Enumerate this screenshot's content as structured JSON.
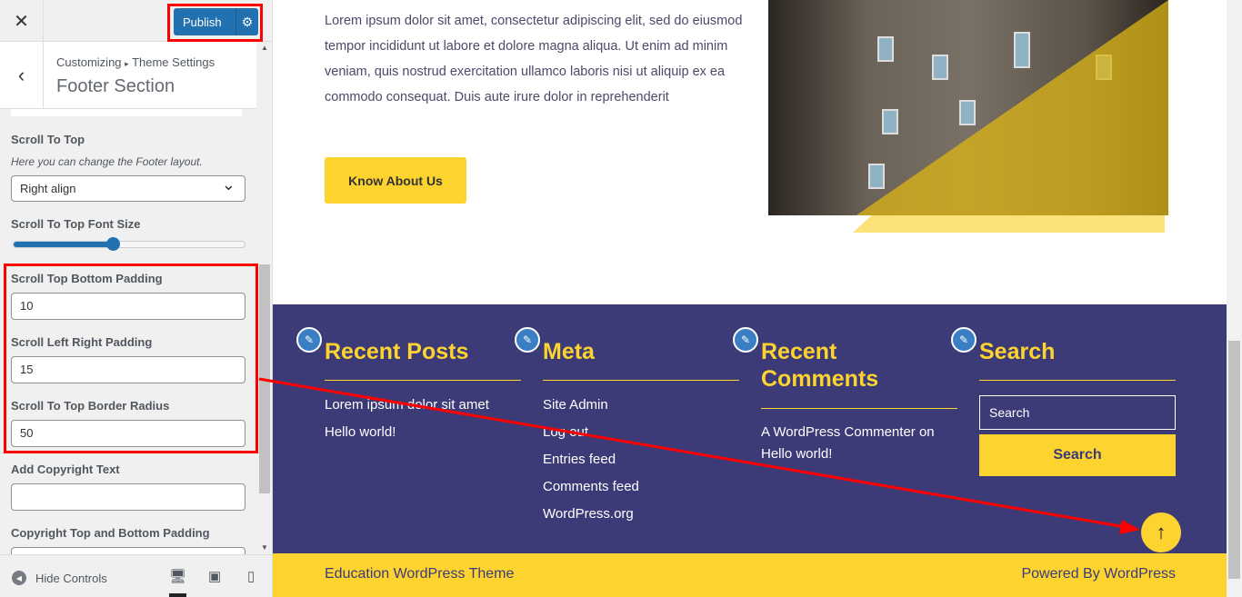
{
  "sidebar": {
    "close_icon": "close-icon",
    "publish_label": "Publish",
    "breadcrumb_root": "Customizing",
    "breadcrumb_sep": "▸",
    "breadcrumb_parent": "Theme Settings",
    "section_title": "Footer Section",
    "controls": {
      "scroll_to_top_label": "Scroll To Top",
      "scroll_to_top_desc": "Here you can change the Footer layout.",
      "scroll_to_top_value": "Right align",
      "font_size_label": "Scroll To Top Font Size",
      "font_size_percent": 43,
      "bottom_padding_label": "Scroll Top Bottom Padding",
      "bottom_padding_value": "10",
      "lr_padding_label": "Scroll Left Right Padding",
      "lr_padding_value": "15",
      "border_radius_label": "Scroll To Top Border Radius",
      "border_radius_value": "50",
      "copyright_label": "Add Copyright Text",
      "copyright_value": "",
      "copyright_padding_label": "Copyright Top and Bottom Padding"
    },
    "hide_controls": "Hide Controls",
    "devices": [
      "desktop",
      "tablet",
      "mobile"
    ]
  },
  "preview": {
    "about_text": "Lorem ipsum dolor sit amet, consectetur adipiscing elit, sed do eiusmod tempor incididunt ut labore et dolore magna aliqua. Ut enim ad minim veniam, quis nostrud exercitation ullamco laboris nisi ut aliquip ex ea commodo consequat. Duis aute irure dolor in reprehenderit",
    "know_button": "Know About Us",
    "footer": {
      "recent_posts": {
        "title": "Recent Posts",
        "items": [
          "Lorem ipsum dolor sit amet",
          "Hello world!"
        ]
      },
      "meta": {
        "title": "Meta",
        "items": [
          "Site Admin",
          "Log out",
          "Entries feed",
          "Comments feed",
          "WordPress.org"
        ]
      },
      "recent_comments": {
        "title": "Recent Comments",
        "text": "A WordPress Commenter on Hello world!"
      },
      "search": {
        "title": "Search",
        "placeholder": "Search",
        "button": "Search"
      }
    },
    "copyright_left": "Education WordPress Theme",
    "copyright_right": "Powered By WordPress"
  },
  "colors": {
    "accent": "#fdd330",
    "footer_bg": "#3c3b77",
    "publish": "#2271b1",
    "annotation": "#ff0000"
  }
}
